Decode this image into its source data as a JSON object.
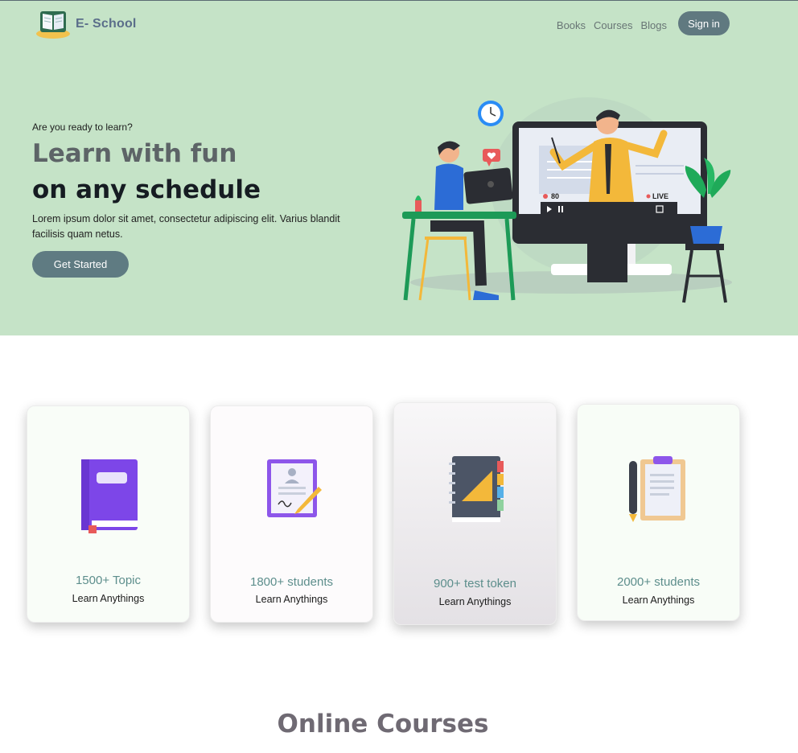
{
  "brand": {
    "name": "E- School"
  },
  "nav": {
    "items": [
      "Books",
      "Courses",
      "Blogs"
    ],
    "signin_label": "Sign in"
  },
  "hero": {
    "eyebrow": "Are you ready to learn?",
    "title_line1": "Learn with fun",
    "title_line2": "on any schedule",
    "description": "Lorem ipsum dolor sit amet, consectetur adipiscing elit. Varius blandit facilisis quam netus.",
    "cta_label": "Get Started",
    "video_views": "80",
    "live_label": "LIVE"
  },
  "stats": [
    {
      "value": "1500+ Topic",
      "label": "Learn Anythings",
      "icon": "book-icon"
    },
    {
      "value": "1800+ students",
      "label": "Learn Anythings",
      "icon": "certificate-icon"
    },
    {
      "value": "900+ test token",
      "label": "Learn Anythings",
      "icon": "notebook-icon"
    },
    {
      "value": "2000+ students",
      "label": "Learn Anythings",
      "icon": "clipboard-icon"
    }
  ],
  "section": {
    "title": "Online Courses"
  },
  "colors": {
    "hero_bg": "#c5e3c7",
    "accent": "#607980",
    "stat_text": "#5d8e8c"
  }
}
